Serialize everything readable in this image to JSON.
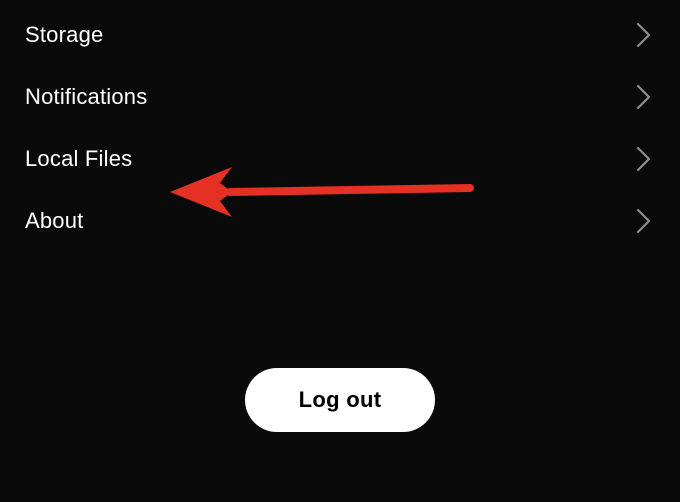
{
  "menu": {
    "items": [
      {
        "label": "Storage"
      },
      {
        "label": "Notifications"
      },
      {
        "label": "Local Files"
      },
      {
        "label": "About"
      }
    ]
  },
  "logout": {
    "label": "Log out"
  },
  "colors": {
    "annotation_arrow": "#e53124"
  }
}
